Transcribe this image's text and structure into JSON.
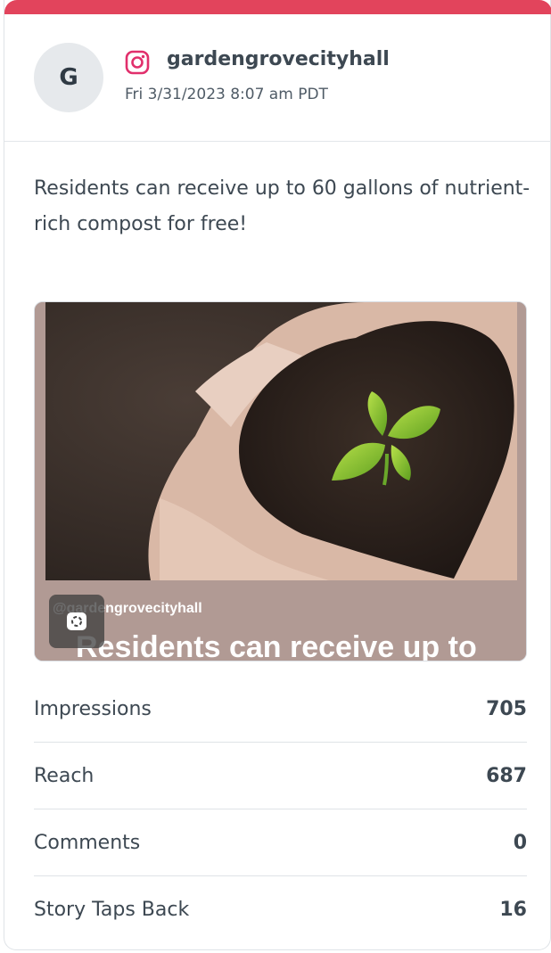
{
  "post": {
    "avatar_initial": "G",
    "platform_icon": "instagram-icon",
    "account": "gardengrovecityhall",
    "timestamp": "Fri 3/31/2023 8:07 am PDT",
    "caption": "Residents can receive up to 60 gallons of nutrient-rich compost for free!"
  },
  "media": {
    "overlay_handle": "@gardengrovecityhall",
    "overlay_headline": "Residents can receive up to",
    "story_icon": "story-icon"
  },
  "stats": [
    {
      "label": "Impressions",
      "value": "705"
    },
    {
      "label": "Reach",
      "value": "687"
    },
    {
      "label": "Comments",
      "value": "0"
    },
    {
      "label": "Story Taps Back",
      "value": "16"
    }
  ],
  "colors": {
    "accent_bar": "#e2445c",
    "instagram": "#e1306c"
  }
}
